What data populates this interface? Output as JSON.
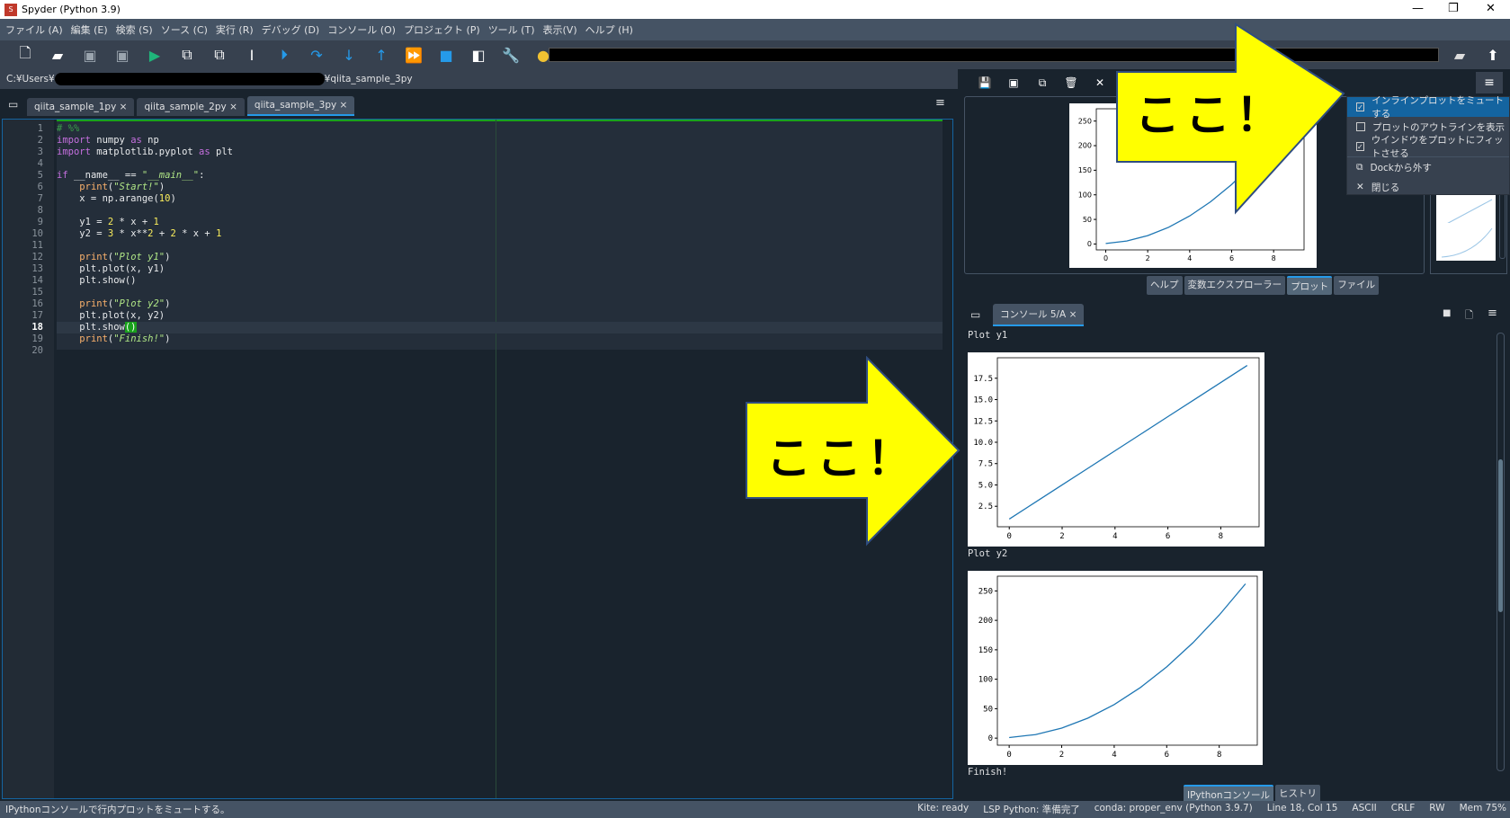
{
  "window": {
    "title": "Spyder (Python 3.9)",
    "controls": [
      "—",
      "❐",
      "✕"
    ]
  },
  "menu": [
    "ファイル (A)",
    "編集 (E)",
    "検索 (S)",
    "ソース (C)",
    "実行 (R)",
    "デバッグ (D)",
    "コンソール (O)",
    "プロジェクト (P)",
    "ツール (T)",
    "表示(V)",
    "ヘルプ (H)"
  ],
  "toolbar": {
    "icons": [
      "new-file",
      "open-file",
      "save",
      "save-all",
      "run",
      "run-cell",
      "run-cell-advance",
      "run-selection",
      "debug",
      "step",
      "step-into",
      "step-return",
      "continue",
      "stop",
      "maximize-pane",
      "preferences",
      "python-path"
    ]
  },
  "path": {
    "prefix": "C:¥Users¥",
    "suffix": "¥qiita_sample_3py"
  },
  "editor": {
    "tabs": [
      {
        "label": "qiita_sample_1py",
        "close": "×"
      },
      {
        "label": "qiita_sample_2py",
        "close": "×"
      },
      {
        "label": "qiita_sample_3py",
        "close": "×"
      }
    ],
    "current_line": 18,
    "lines": [
      [
        [
          "# %%",
          "cm"
        ]
      ],
      [
        [
          "import",
          "kw"
        ],
        [
          " numpy ",
          "df"
        ],
        [
          "as",
          "kw"
        ],
        [
          " np",
          "df"
        ]
      ],
      [
        [
          "import",
          "kw"
        ],
        [
          " matplotlib.pyplot ",
          "df"
        ],
        [
          "as",
          "kw"
        ],
        [
          " plt",
          "df"
        ]
      ],
      [],
      [
        [
          "if",
          "kw"
        ],
        [
          " __name__ == ",
          "df"
        ],
        [
          "\"__main__\"",
          "st"
        ],
        [
          ":",
          "df"
        ]
      ],
      [
        [
          "    ",
          "df"
        ],
        [
          "print",
          "bi"
        ],
        [
          "(",
          "df"
        ],
        [
          "\"Start!\"",
          "st"
        ],
        [
          ")",
          "df"
        ]
      ],
      [
        [
          "    x = np.arange(",
          "df"
        ],
        [
          "10",
          "nm"
        ],
        [
          ")",
          "df"
        ]
      ],
      [],
      [
        [
          "    y1 = ",
          "df"
        ],
        [
          "2",
          "nm"
        ],
        [
          " * x + ",
          "df"
        ],
        [
          "1",
          "nm"
        ]
      ],
      [
        [
          "    y2 = ",
          "df"
        ],
        [
          "3",
          "nm"
        ],
        [
          " * x**",
          "df"
        ],
        [
          "2",
          "nm"
        ],
        [
          " + ",
          "df"
        ],
        [
          "2",
          "nm"
        ],
        [
          " * x + ",
          "df"
        ],
        [
          "1",
          "nm"
        ]
      ],
      [],
      [
        [
          "    ",
          "df"
        ],
        [
          "print",
          "bi"
        ],
        [
          "(",
          "df"
        ],
        [
          "\"Plot y1\"",
          "st"
        ],
        [
          ")",
          "df"
        ]
      ],
      [
        [
          "    plt.plot(x, y1)",
          "df"
        ]
      ],
      [
        [
          "    plt.show()",
          "df"
        ]
      ],
      [],
      [
        [
          "    ",
          "df"
        ],
        [
          "print",
          "bi"
        ],
        [
          "(",
          "df"
        ],
        [
          "\"Plot y2\"",
          "st"
        ],
        [
          ")",
          "df"
        ]
      ],
      [
        [
          "    plt.plot(x, y2)",
          "df"
        ]
      ],
      [
        [
          "    plt.show",
          "df"
        ],
        [
          "()",
          "brk"
        ]
      ],
      [
        [
          "    ",
          "df"
        ],
        [
          "print",
          "bi"
        ],
        [
          "(",
          "df"
        ],
        [
          "\"Finish!\"",
          "st"
        ],
        [
          ")",
          "df"
        ]
      ],
      []
    ]
  },
  "plots_pane": {
    "toolbar_icons": [
      "save",
      "save-all",
      "copy",
      "delete",
      "close-all"
    ],
    "menu": [
      {
        "label": "インラインプロットをミュートする",
        "checked": true,
        "icon": "☑"
      },
      {
        "label": "プロットのアウトラインを表示",
        "checked": false,
        "icon": "☐"
      },
      {
        "label": "ウインドウをプロットにフィットさせる",
        "checked": true,
        "icon": "☑"
      },
      {
        "label": "Dockから外す",
        "icon": "⧉"
      },
      {
        "label": "閉じる",
        "icon": "✕"
      }
    ],
    "tabs": [
      "ヘルプ",
      "変数エクスプローラー",
      "プロット",
      "ファイル"
    ],
    "active_tab": "プロット"
  },
  "console": {
    "tab": "コンソール 5/A",
    "tab_close": "×",
    "outputs": [
      "Plot y1",
      "Plot y2",
      "Finish!"
    ],
    "tabs": [
      "IPythonコンソール",
      "ヒストリ"
    ]
  },
  "annotations": {
    "callout_1": "ここ！",
    "callout_2": "ここ！",
    "color": "#ffff00"
  },
  "status": {
    "message": "IPythonコンソールで行内プロットをミュートする。",
    "items": [
      "Kite: ready",
      "LSP Python: 準備完了",
      "conda: proper_env (Python 3.9.7)",
      "Line 18, Col 15",
      "ASCII",
      "CRLF",
      "RW",
      "Mem 75%"
    ]
  },
  "chart_data": [
    {
      "type": "line",
      "title": "Plot y1",
      "x": [
        0,
        1,
        2,
        3,
        4,
        5,
        6,
        7,
        8,
        9
      ],
      "values": [
        1,
        3,
        5,
        7,
        9,
        11,
        13,
        15,
        17,
        19
      ],
      "xticks": [
        0,
        2,
        4,
        6,
        8
      ],
      "yticks": [
        2.5,
        5.0,
        7.5,
        10.0,
        12.5,
        15.0,
        17.5
      ],
      "ylim": [
        0.1,
        19.9
      ],
      "xlim": [
        -0.45,
        9.45
      ],
      "color": "#1f77b4"
    },
    {
      "type": "line",
      "title": "Plot y2",
      "x": [
        0,
        1,
        2,
        3,
        4,
        5,
        6,
        7,
        8,
        9
      ],
      "values": [
        1,
        6,
        17,
        34,
        57,
        86,
        121,
        162,
        209,
        262
      ],
      "xticks": [
        0,
        2,
        4,
        6,
        8
      ],
      "yticks": [
        0,
        50,
        100,
        150,
        200,
        250
      ],
      "ylim": [
        -12,
        275
      ],
      "xlim": [
        -0.45,
        9.45
      ],
      "color": "#1f77b4"
    }
  ]
}
